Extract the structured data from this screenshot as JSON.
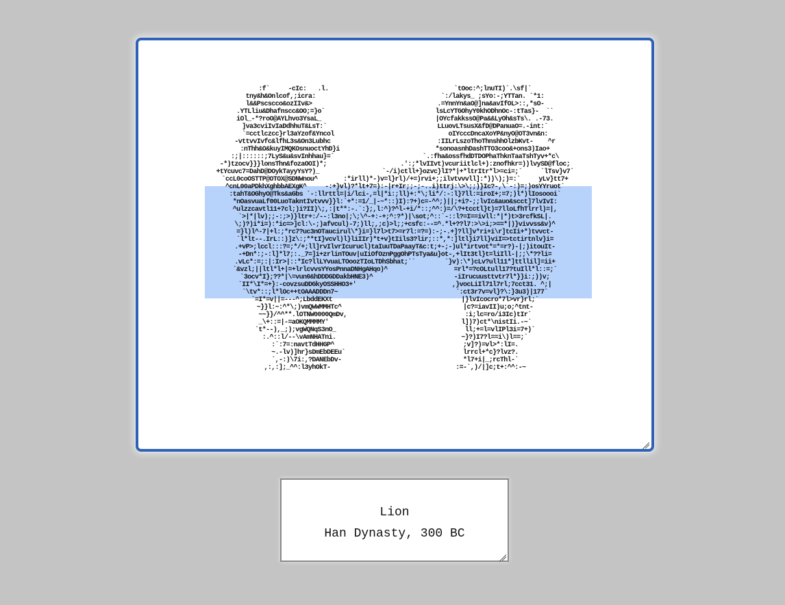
{
  "artwork": {
    "ascii_lines": [
      ":f`     -cIc:   .l.                                  `tOoc:^;lnuTI)`.\\sf|`",
      "tny&h&Onlcof,;icra:                                  `:/lakys_ ;sYo:-;YTTan. `*1:",
      "l&&Pscscco&ozIIv&>                                  .=YnnYn&aO@]na&avIfOL>::,*sO-",
      ".YTLliu&Dhafnscc&OO;=}o`                              lsLcYTGOhyY0khODhnOc-:tTas}-  ``",
      "iOl_-*?roO@AYLhvo3YsaL_                               |OYcfakkssO@Pa&&LyOh&sTs\\. .-73.",
      "]va3cviIvIaDdhhuT&LsT:`                              LLuovLTsusX&fD@DPanuaO=.-int:`",
      "`=cctlczcc}rl3aYzof&Yncol                               oIYcccDncaXoYP&nyO@OT3vn&n:",
      "-vttvvIvfc&lfhL3s&On3Lubhc                             :IILrLszoThoThnshhOlzbKvt-    ^r",
      ":nThh&O&kuyIMQKOsnuoctYhD}i                          *sonoasnhDashTTO3coo&+ons3)Iao+",
      ":;|::::::;7LyS&u&svInhhau}=`                        `.:fha&ossfhdDTDOPhaThknTaaTshTyv+*c\\",
      "-*)tzocv}}}lonsThn&fozaOOI)*;                    .':;*lvIIvt)vcuriitlcl+):znofhkr=))lvySD@floc;",
      "+tYcuvc7=DahD@DOykTayyYsY?)_                 `-/i)ctll+}ozvc}lI?*|+*ltrItr*l>=ci=;`     `lTsv}v7`",
      "`ccL0coOSTTP@OTOX@SDNWnou^       :*irll)*-)v=l}rl)/+=)rvi+;;ilvtvvvll]:*))\\);)=:`     yLv}tt7+",
      "^cnL00aPDkhXghbbAEXgK^     -:+}vl)?*lt+7=):-|r+Ir;;-;-..i)ttrj:\\>\\;;)}Ic?-,\\`-:)=;)osYYruot`",
      ":tahT&OGhyO@Tks&aGbs `-:llrttl=|i/lci-,=l|*i:;ll)+:*\\;li*/:-:l}7ll:=iroI+;=7;)l*)lIosoooi`",
      "*nOasvuaLf00LuoTakntIvtvvv}}l:`+*:=1/_|-~*::)I):?+)c=-^^;)||;+i?-;;lvIc&auo&scct]7lvIvI:",
      "^ulzzcavtl11+7cl;)i?II)\\;,:|t**:-.`:};,l:^)?^l-+i/*::;^^:)=/\\?+tcctl}t)=7lloLfhTlrrl)=|,",
      "`>|*|lv);;-:;>)}ltr+:/--:l3no|;\\;\\^-+:-+;^:?*)|\\sot;^::`-::l?=I==ivll:*|*)t>3rcfkSL|.",
      "\\;)?)i*i=):*ic=>]cl:\\-;)afvcul)-7;)ll;,;c)>l;;+csfc:--=^.*l+??l7:>\\>i;>==*|)}vivvss&v)^",
      "=}l)l^-7|+l:;*rc7?uc3nOTaucirul\\*}i=}l7l>t7>=r7l:=?=):-;-.+]?ll]v*ri+i\\r]tcIi+*)tvvct-",
      "`l*lt--.IrL::)]z\\:;**tI}vcvl)l}liIIr)*t+v}tIils3?lir;::*,*:]ltl}i7ll}viI=>tctirtnlv}i=",
      ".+vP>;lccl:::?=;*/+;ll]rvIlvrIcurucl)taIuuTDaPaayT&c:t;+-;-)ul*irtvot*=*=r?)-|;)itouIt-",
      "-+Dn*:;-:l]*l7;:._7=]i+zrlinTOuv|uIiOfOznPggOhPTsTya&u}ot-,+lIt3tl}t=liIll-|;;\\*??li=",
      ".vLc*:=;:|:Ir>|::*Ic?llLYvuaLTOoozTIoLTDhSbhat;``        `}v):\\*)cLv?ull11*]ttllil]=ii+",
      "`&vzl;||ltl*l+|=+lrlcvvsYYosPnnaDNHgAHqo)^                  =rl*=?cOLtull17?tuIll*l::=;`",
      "`3ocv*I};??*|\\=vun0&hDDDGDDakbHNE3)^                      -iIrucuusttvtr7l*}}i:;))v;",
      "`II*\\I*=+}:-covzsuDDGkyOSSHHO3+'                          ,}vocLiIl71l7rl;7cct31. ^;|",
      "`\\tv*::;l*lOc++tOAAADDDn7~                                `:ct3r7v=vl}?\\:}3u3)|177`",
      "`=I*=v||=---^;LbddEKXt                                   |}lvIcocro*7l>vr}rl;`",
      "~}}l:~:^*\\;)vmQWWMMHTc^                                 |c?=iavII)u;o;^tnt-",
      "~~}}/^^**.lOTNW0000QmDv,                                :i;lc=ro/i3Ic)tIr`",
      "_\\+::=|-=aOKQMMMMY'                                    l])7)ct*\\nistIi.-~`",
      "`t*--),_;);vgWQNqS3nO_                                   ll;+=l=vlIPl3i=7+)`",
      ":.^::l/--\\vAmNHATni.                                  ~}?)I7?l==i\\)l==;`",
      ":`:7=:navtTdHHGP^                                   ;v]?)=vl>*:lI=.",
      "~.-lv)]hr}sDmEbDEEu`                                lrrcl+*c}?lvz?.",
      "`,-:)\\7i:,?DANEbDv-                                 *l7+i|_;rcThl-`",
      ",:,:];_^^:l3yhOkT-                                  :=-`,)/|]c;t+:^^:-~"
    ],
    "selection_color": "#b8d3fb",
    "frame_color": "#2d62b6"
  },
  "caption": {
    "title": "Lion",
    "subtitle": "Han Dynasty, 300 BC"
  },
  "icons": {
    "frame_grip": "resize-grip-icon",
    "caption_grip": "resize-grip-icon"
  }
}
